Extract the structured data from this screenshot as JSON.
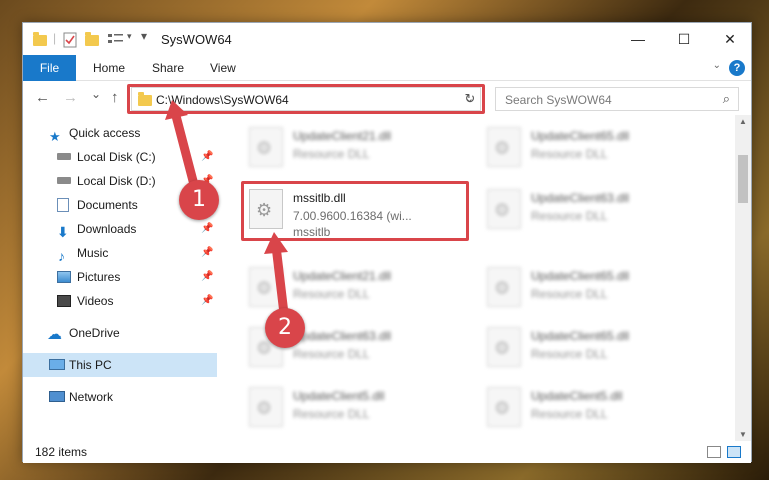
{
  "window": {
    "title": "SysWOW64",
    "minimize": "—",
    "maximize": "☐",
    "close": "✕"
  },
  "ribbon": {
    "tabs": [
      {
        "label": "File"
      },
      {
        "label": "Home"
      },
      {
        "label": "Share"
      },
      {
        "label": "View"
      }
    ],
    "help": "?"
  },
  "nav": {
    "back": "←",
    "forward": "→",
    "recent": "⌄",
    "up": "↑",
    "address": "C:\\Windows\\SysWOW64",
    "refresh": "↻",
    "search_placeholder": "Search SysWOW64"
  },
  "sidebar": {
    "items": [
      {
        "label": "Quick access",
        "icon": "star-icon",
        "pinned": false
      },
      {
        "label": "Local Disk (C:)",
        "icon": "drive-icon",
        "pinned": true
      },
      {
        "label": "Local Disk (D:)",
        "icon": "drive-icon",
        "pinned": true
      },
      {
        "label": "Documents",
        "icon": "documents-icon",
        "pinned": true
      },
      {
        "label": "Downloads",
        "icon": "download-icon",
        "pinned": true
      },
      {
        "label": "Music",
        "icon": "music-icon",
        "pinned": true
      },
      {
        "label": "Pictures",
        "icon": "pictures-icon",
        "pinned": true
      },
      {
        "label": "Videos",
        "icon": "videos-icon",
        "pinned": true
      },
      {
        "label": "OneDrive",
        "icon": "cloud-icon",
        "pinned": false
      },
      {
        "label": "This PC",
        "icon": "computer-icon",
        "pinned": false
      },
      {
        "label": "Network",
        "icon": "network-icon",
        "pinned": false
      }
    ],
    "pin_glyph": "📌"
  },
  "files": {
    "selected": {
      "name": "mssitlb.dll",
      "version": "7.00.9600.16384 (wi...",
      "description": "mssitlb"
    },
    "background": [
      {
        "name": "UpdateClient21.dll",
        "type": "Resource DLL"
      },
      {
        "name": "UpdateClient65.dll",
        "type": "Resource DLL"
      },
      {
        "name": "UpdateClient63.dll",
        "type": "Resource DLL"
      },
      {
        "name": "UpdateClient21.dll",
        "type": "Resource DLL"
      },
      {
        "name": "UpdateClient65.dll",
        "type": "Resource DLL"
      },
      {
        "name": "UpdateClient63.dll",
        "type": "Resource DLL"
      },
      {
        "name": "UpdateClient65.dll",
        "type": "Resource DLL"
      },
      {
        "name": "UpdateClient5.dll",
        "type": "Resource DLL"
      },
      {
        "name": "UpdateClient5.dll",
        "type": "Resource DLL"
      }
    ]
  },
  "status": {
    "item_count": "182 items"
  },
  "annotations": {
    "step1": "1",
    "step2": "2",
    "color": "#d9454a"
  }
}
